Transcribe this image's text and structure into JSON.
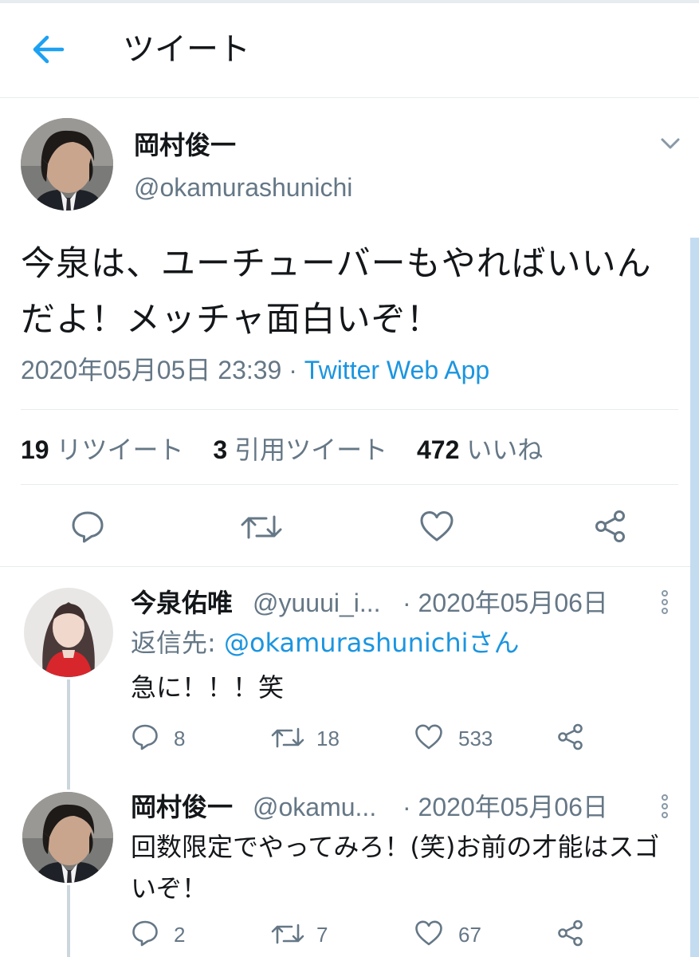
{
  "header": {
    "title": "ツイート",
    "back_icon": "arrow-left-icon",
    "accent_color": "#1da1f2"
  },
  "main_tweet": {
    "author_name": "岡村俊一",
    "author_handle": "@okamurashunichi",
    "text": "今泉は、ユーチューバーもやればいいんだよ！メッチャ面白いぞ！",
    "timestamp": "2020年05月05日 23:39",
    "separator": " · ",
    "source": "Twitter Web App",
    "stats": {
      "retweets_count": "19",
      "retweets_label": "リツイート",
      "quotes_count": "3",
      "quotes_label": "引用ツイート",
      "likes_count": "472",
      "likes_label": "いいね"
    },
    "actions": [
      "reply-icon",
      "retweet-icon",
      "like-icon",
      "share-icon"
    ]
  },
  "replies": [
    {
      "author_name": "今泉佑唯",
      "author_handle": "@yuuui_i...",
      "date": "· 2020年05月06日",
      "reply_to_prefix": "返信先: ",
      "reply_to_user": "@okamurashunichiさん",
      "text": "急に！！！笑",
      "reply_count": "8",
      "retweet_count": "18",
      "like_count": "533"
    },
    {
      "author_name": "岡村俊一",
      "author_handle": "@okamu...",
      "date": "· 2020年05月06日",
      "text": "回数限定でやってみろ！(笑)お前の才能はスゴいぞ！",
      "reply_count": "2",
      "retweet_count": "7",
      "like_count": "67"
    }
  ],
  "colors": {
    "text_primary": "#14171a",
    "text_secondary": "#657786",
    "link": "#1b95e0",
    "divider": "#e6ecf0"
  }
}
